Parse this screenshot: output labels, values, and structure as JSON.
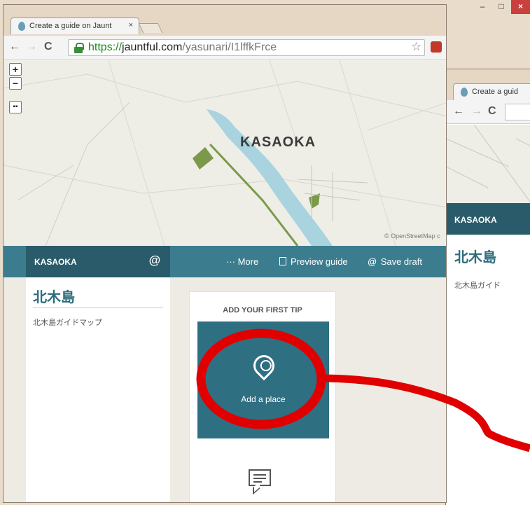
{
  "browser": {
    "tab_title": "Create a guide on Jaunt",
    "tab_close": "×",
    "url_scheme": "https://",
    "url_host": "jauntful.com",
    "url_path": "/yasunari/I1lffkFrce",
    "minimize": "–",
    "maximize": "□",
    "close": "×"
  },
  "map": {
    "zoom_in": "+",
    "zoom_out": "−",
    "city_label": "KASAOKA",
    "attribution": "© OpenStreetMap c"
  },
  "header": {
    "guide_city": "KASAOKA",
    "feather_glyph": "@",
    "more": "··· More",
    "preview": "Preview guide",
    "save": "Save draft"
  },
  "guide": {
    "title": "北木島",
    "description": "北木島ガイドマップ"
  },
  "tip_card": {
    "heading": "ADD YOUR FIRST TIP",
    "add_place": "Add a place"
  },
  "back_window": {
    "tab_title": "Create a guid",
    "guide_city": "KASAOKA",
    "title": "北木島",
    "description": "北木島ガイド"
  },
  "colors": {
    "teal_dark": "#2a5b6a",
    "teal": "#3b7d8e",
    "tile": "#2f6f82",
    "annotation_red": "#e00000"
  }
}
